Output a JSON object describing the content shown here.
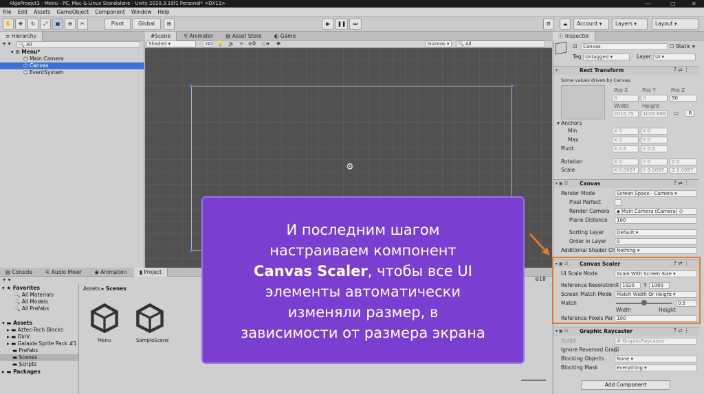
{
  "window": {
    "title": "AlgoProejct3 - Menu - PC, Mac & Linux Standalone - Unity 2020.3.19f1 Personal* <DX11>"
  },
  "menu": [
    "File",
    "Edit",
    "Assets",
    "GameObject",
    "Component",
    "Window",
    "Help"
  ],
  "toolbar": {
    "pivot": "Pivot",
    "global": "Global",
    "account": "Account",
    "layers": "Layers",
    "layout": "Layout"
  },
  "hierarchy": {
    "tab": "Hierarchy",
    "search_placeholder": "All",
    "scene": "Menu*",
    "items": [
      "Main Camera",
      "Canvas",
      "EventSystem"
    ]
  },
  "scene_tabs": [
    "Scene",
    "Animator",
    "Asset Store",
    "Game"
  ],
  "scene_toolbar": {
    "shading": "Shaded",
    "mode": "2D",
    "gizmos": "Gizmos",
    "search": "All"
  },
  "bottom_tabs": [
    "Console",
    "Audio Mixer",
    "Animation",
    "Project"
  ],
  "project": {
    "favorites": "Favorites",
    "fav_items": [
      "All Materials",
      "All Models",
      "All Prefabs"
    ],
    "assets": "Assets",
    "asset_folders": [
      "Aztec-Tech Blocks",
      "DinV",
      "Galaxia Sprite Pack #1",
      "Prefabs",
      "Scenes",
      "Scripts"
    ],
    "packages": "Packages",
    "breadcrumb_root": "Assets",
    "breadcrumb_leaf": "Scenes",
    "files": [
      "Menu",
      "SampleScene"
    ],
    "count": "18"
  },
  "inspector": {
    "tab": "Inspector",
    "name": "Canvas",
    "static": "Static",
    "tag_label": "Tag",
    "tag": "Untagged",
    "layer_label": "Layer",
    "layer": "UI",
    "rect": {
      "title": "Rect Transform",
      "note": "Some values driven by Canvas.",
      "posx": "Pos X",
      "posy": "Pos Y",
      "posz": "Pos Z",
      "px": "0",
      "py": "0",
      "pz": "90",
      "width_label": "Width",
      "height_label": "Height",
      "width": "2015.75",
      "height": "1028.688",
      "anchors": "Anchors",
      "min": "Min",
      "max": "Max",
      "pivot": "Pivot",
      "minx": "0",
      "miny": "0",
      "maxx": "0",
      "maxy": "0",
      "pivx": "0.5",
      "pivy": "0.5",
      "rotation": "Rotation",
      "rx": "0",
      "ry": "0",
      "rz": "0",
      "scale": "Scale",
      "sx": "0.0097",
      "sy": "0.0097",
      "sz": "0.0097",
      "r_btn": "R"
    },
    "canvas": {
      "title": "Canvas",
      "render_mode_label": "Render Mode",
      "render_mode": "Screen Space - Camera",
      "pixel_perfect": "Pixel Perfect",
      "render_camera_label": "Render Camera",
      "render_camera": "Main Camera (Camera)",
      "plane_distance_label": "Plane Distance",
      "plane_distance": "100",
      "sorting_layer_label": "Sorting Layer",
      "sorting_layer": "Default",
      "order_label": "Order in Layer",
      "order": "0",
      "shader_label": "Additional Shader Ch",
      "shader": "Nothing"
    },
    "scaler": {
      "title": "Canvas Scaler",
      "ui_scale_label": "UI Scale Mode",
      "ui_scale": "Scale With Screen Size",
      "ref_res_label": "Reference Resolution",
      "x_label": "X",
      "ref_x": "1920",
      "y_label": "Y",
      "ref_y": "1080",
      "match_mode_label": "Screen Match Mode",
      "match_mode": "Match Width Or Height",
      "match_label": "Match",
      "match": "0.5",
      "width_label": "Width",
      "height_label": "Height",
      "ppu_label": "Reference Pixels Per",
      "ppu": "100"
    },
    "raycaster": {
      "title": "Graphic Raycaster",
      "script_label": "Script",
      "script": "GraphicRaycaster",
      "ignore_label": "Ignore Reversed Grap",
      "blocking_objects_label": "Blocking Objects",
      "blocking_objects": "None",
      "blocking_mask_label": "Blocking Mask",
      "blocking_mask": "Everything"
    },
    "add_component": "Add Component"
  },
  "overlay": {
    "line1": "И последним шагом",
    "line2": "настраиваем компонент",
    "bold": "Canvas Scaler",
    "line3_rest": ", чтобы все UI",
    "line4": "элементы автоматически",
    "line5": "изменяли размер, в",
    "line6": "зависимости от размера экрана"
  },
  "colors": {
    "overlay": "#7a3fd1",
    "highlight": "#e07a2e",
    "selection": "#3a72d6"
  }
}
